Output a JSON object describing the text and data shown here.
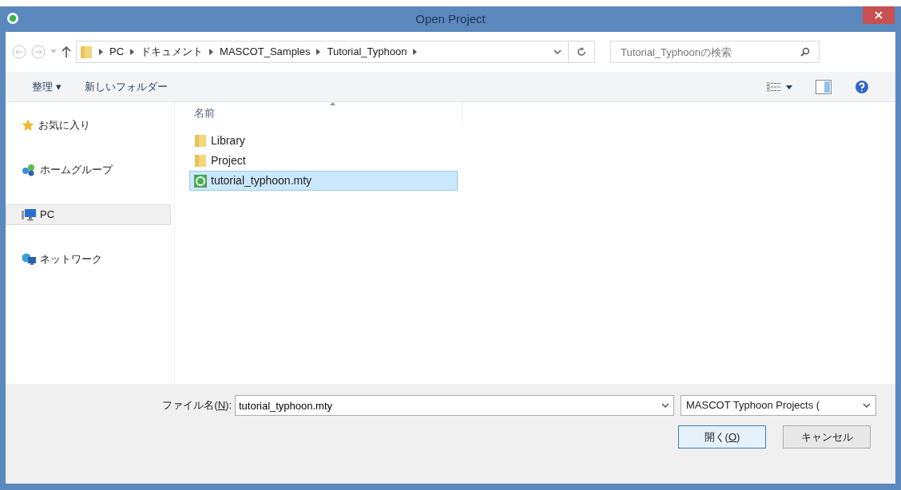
{
  "window": {
    "title": "Open Project"
  },
  "nav": {
    "path": [
      {
        "label": "PC"
      },
      {
        "label": "ドキュメント"
      },
      {
        "label": "MASCOT_Samples"
      },
      {
        "label": "Tutorial_Typhoon"
      }
    ],
    "search_placeholder": "Tutorial_Typhoonの検索"
  },
  "toolbar": {
    "organize": "整理 ▾",
    "new_folder": "新しいフォルダー"
  },
  "sidebar": {
    "items": [
      {
        "kind": "favorites",
        "label": "お気に入り",
        "selected": false
      },
      {
        "kind": "homegroup",
        "label": "ホームグループ",
        "selected": false
      },
      {
        "kind": "pc",
        "label": "PC",
        "selected": true
      },
      {
        "kind": "network",
        "label": "ネットワーク",
        "selected": false
      }
    ]
  },
  "file_list": {
    "column": "名前",
    "items": [
      {
        "kind": "folder",
        "name": "Library",
        "selected": false
      },
      {
        "kind": "folder",
        "name": "Project",
        "selected": false
      },
      {
        "kind": "project",
        "name": "tutorial_typhoon.mty",
        "selected": true
      }
    ]
  },
  "footer": {
    "filename_label": {
      "before": "ファイル名(",
      "mnemonic": "N",
      "after": "):"
    },
    "filename": "tutorial_typhoon.mty",
    "filter": "MASCOT Typhoon Projects (",
    "open_button": {
      "before": "開く(",
      "mnemonic": "O",
      "after": ")"
    },
    "cancel_button": "キャンセル"
  }
}
